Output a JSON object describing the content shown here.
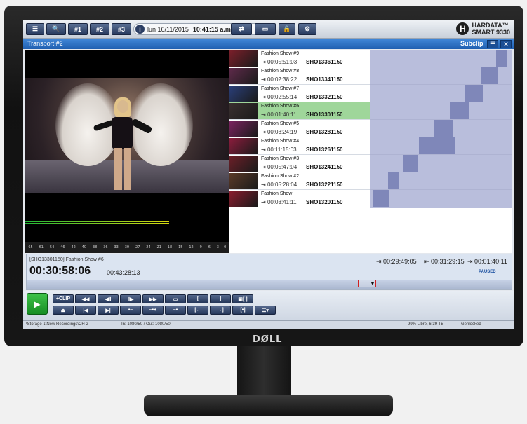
{
  "toolbar": {
    "buttons": [
      "#1",
      "#2",
      "#3"
    ],
    "date": "lun 16/11/2015",
    "time": "10:41:15 a.m.",
    "info_icon": "i",
    "brand": {
      "line1": "HARDATA™",
      "line2": "SMART 9330",
      "mark": "H"
    }
  },
  "window": {
    "title": "Transport #2",
    "subclip_label": "Subclip"
  },
  "monitor_brand": "DØLL",
  "video": {
    "scale": [
      "-65",
      "-61",
      "-54",
      "-46",
      "-42",
      "-40",
      "-38",
      "-36",
      "-33",
      "-30",
      "-27",
      "-24",
      "-21",
      "-18",
      "-15",
      "-12",
      "-9",
      "-6",
      "-3",
      "0"
    ]
  },
  "clips": [
    {
      "name": "Fashion Show #9",
      "duration": "00:05:51:03",
      "id": "SHO13361150",
      "thumb_color": "#7a1f2a"
    },
    {
      "name": "Fashion Show #8",
      "duration": "00:02:38:22",
      "id": "SHO13341150",
      "thumb_color": "#5e2a4a"
    },
    {
      "name": "Fashion Show #7",
      "duration": "00:02:55:14",
      "id": "SHO13321150",
      "thumb_color": "#2a3f7a"
    },
    {
      "name": "Fashion Show #6",
      "duration": "00:01:40:11",
      "id": "SHO13301150",
      "thumb_color": "#3a2f2f",
      "active": true
    },
    {
      "name": "Fashion Show #5",
      "duration": "00:03:24:19",
      "id": "SHO13281150",
      "thumb_color": "#7c2360"
    },
    {
      "name": "Fashion Show #4",
      "duration": "00:11:15:03",
      "id": "SHO13261150",
      "thumb_color": "#8a1c3c"
    },
    {
      "name": "Fashion Show #3",
      "duration": "00:05:47:04",
      "id": "SHO13241150",
      "thumb_color": "#6c1f28"
    },
    {
      "name": "Fashion Show #2",
      "duration": "00:05:28:04",
      "id": "SHO13221150",
      "thumb_color": "#5a3a28"
    },
    {
      "name": "Fashion Show",
      "duration": "00:03:41:11",
      "id": "SHO13201150",
      "thumb_color": "#8b1c2e"
    }
  ],
  "status": {
    "clip_label": "[SHO13301150] Fashion Show #6",
    "timecode": "00:30:58:06",
    "duration": "00:43:28:13",
    "in_point": "00:29:49:05",
    "out_point": "00:31:29:15",
    "length": "00:01:40:11",
    "state": "PAUSED"
  },
  "controls": {
    "clip_label": "+CLIP"
  },
  "statusbar": {
    "path": "\\Storage 1\\New Recordings\\CH 2",
    "io": "In: 1080/50 / Out: 1080/50",
    "storage": "99% Libre, 6,39 TB",
    "sync": "Genlocked"
  }
}
